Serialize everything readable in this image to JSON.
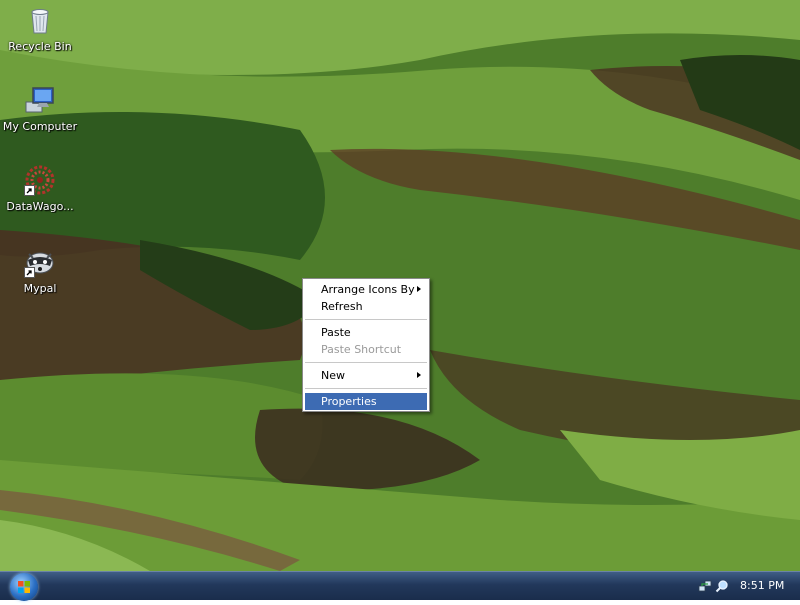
{
  "desktop": {
    "icons": [
      {
        "label": "Recycle Bin",
        "icon": "recycle-bin-icon"
      },
      {
        "label": "My Computer",
        "icon": "my-computer-icon"
      },
      {
        "label": "DataWago...",
        "icon": "datawagon-icon"
      },
      {
        "label": "Mypal",
        "icon": "mypal-icon"
      }
    ]
  },
  "context_menu": {
    "items": [
      {
        "label": "Arrange Icons By",
        "submenu": true,
        "enabled": true
      },
      {
        "label": "Refresh",
        "enabled": true
      },
      {
        "label": "Paste",
        "enabled": true
      },
      {
        "label": "Paste Shortcut",
        "enabled": false
      },
      {
        "label": "New",
        "submenu": true,
        "enabled": true
      },
      {
        "label": "Properties",
        "enabled": true,
        "highlighted": true
      }
    ],
    "highlight_color": "#3d6bb3"
  },
  "taskbar": {
    "start_button": "start-orb-icon",
    "tray": {
      "icons": [
        "network-icon",
        "search-icon"
      ],
      "clock": "8:51 PM"
    }
  }
}
